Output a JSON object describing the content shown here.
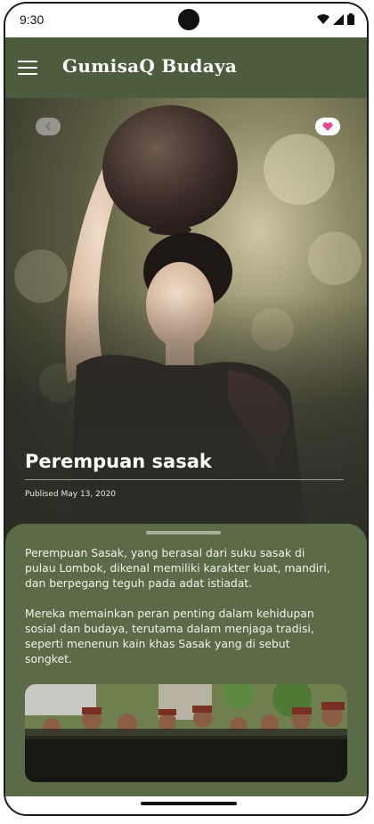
{
  "status_bar": {
    "time": "9:30"
  },
  "app_bar": {
    "title": "GumisaQ Budaya"
  },
  "article": {
    "title": "Perempuan sasak",
    "date": "Publised May 13, 2020",
    "paragraphs": [
      "Perempuan Sasak, yang berasal dari suku sasak di pulau Lombok, dikenal memiliki karakter kuat, mandiri, dan berpegang teguh pada adat istiadat.",
      "Mereka memainkan peran penting dalam kehidupan sosial dan budaya, terutama dalam menjaga tradisi, seperti menenun kain khas Sasak yang di sebut songket."
    ]
  },
  "colors": {
    "app_bar": "#4d5c3c",
    "sheet": "#5b6b47",
    "favorite": "#e8479a"
  },
  "icons": [
    "menu-icon",
    "back-icon",
    "heart-icon",
    "wifi-icon",
    "signal-icon",
    "battery-icon"
  ]
}
